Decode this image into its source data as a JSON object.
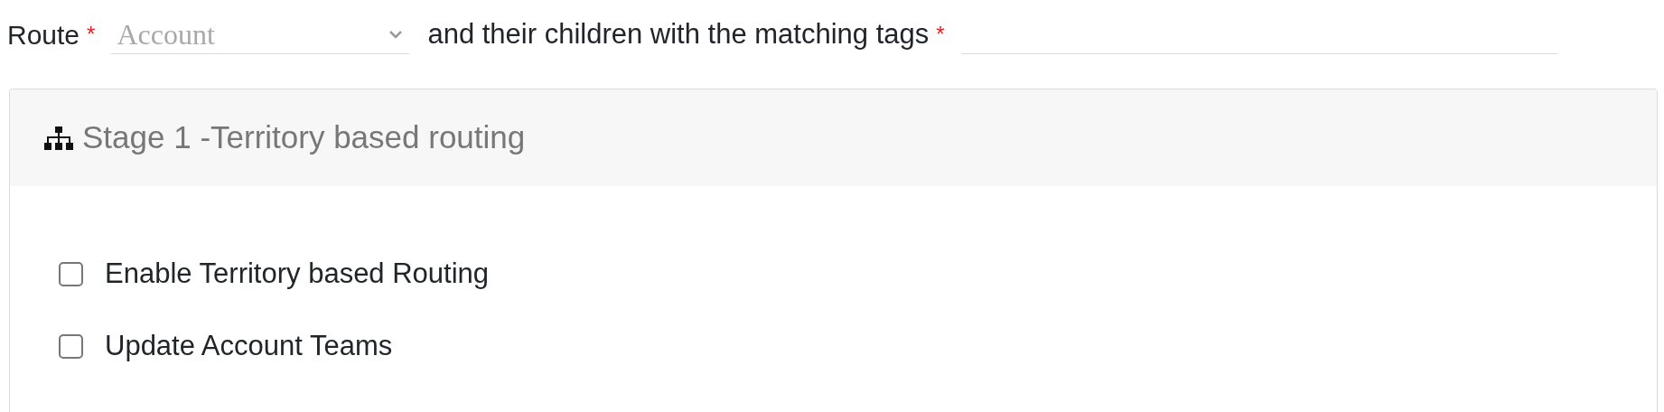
{
  "route": {
    "label": "Route",
    "required_mark": "*",
    "select": {
      "placeholder": "Account"
    }
  },
  "tags": {
    "label": "and their children with the matching tags",
    "required_mark": "*"
  },
  "panel": {
    "title": "Stage 1 -Territory based routing",
    "options": [
      {
        "label": "Enable Territory based Routing",
        "checked": false
      },
      {
        "label": "Update Account Teams",
        "checked": false
      }
    ]
  }
}
